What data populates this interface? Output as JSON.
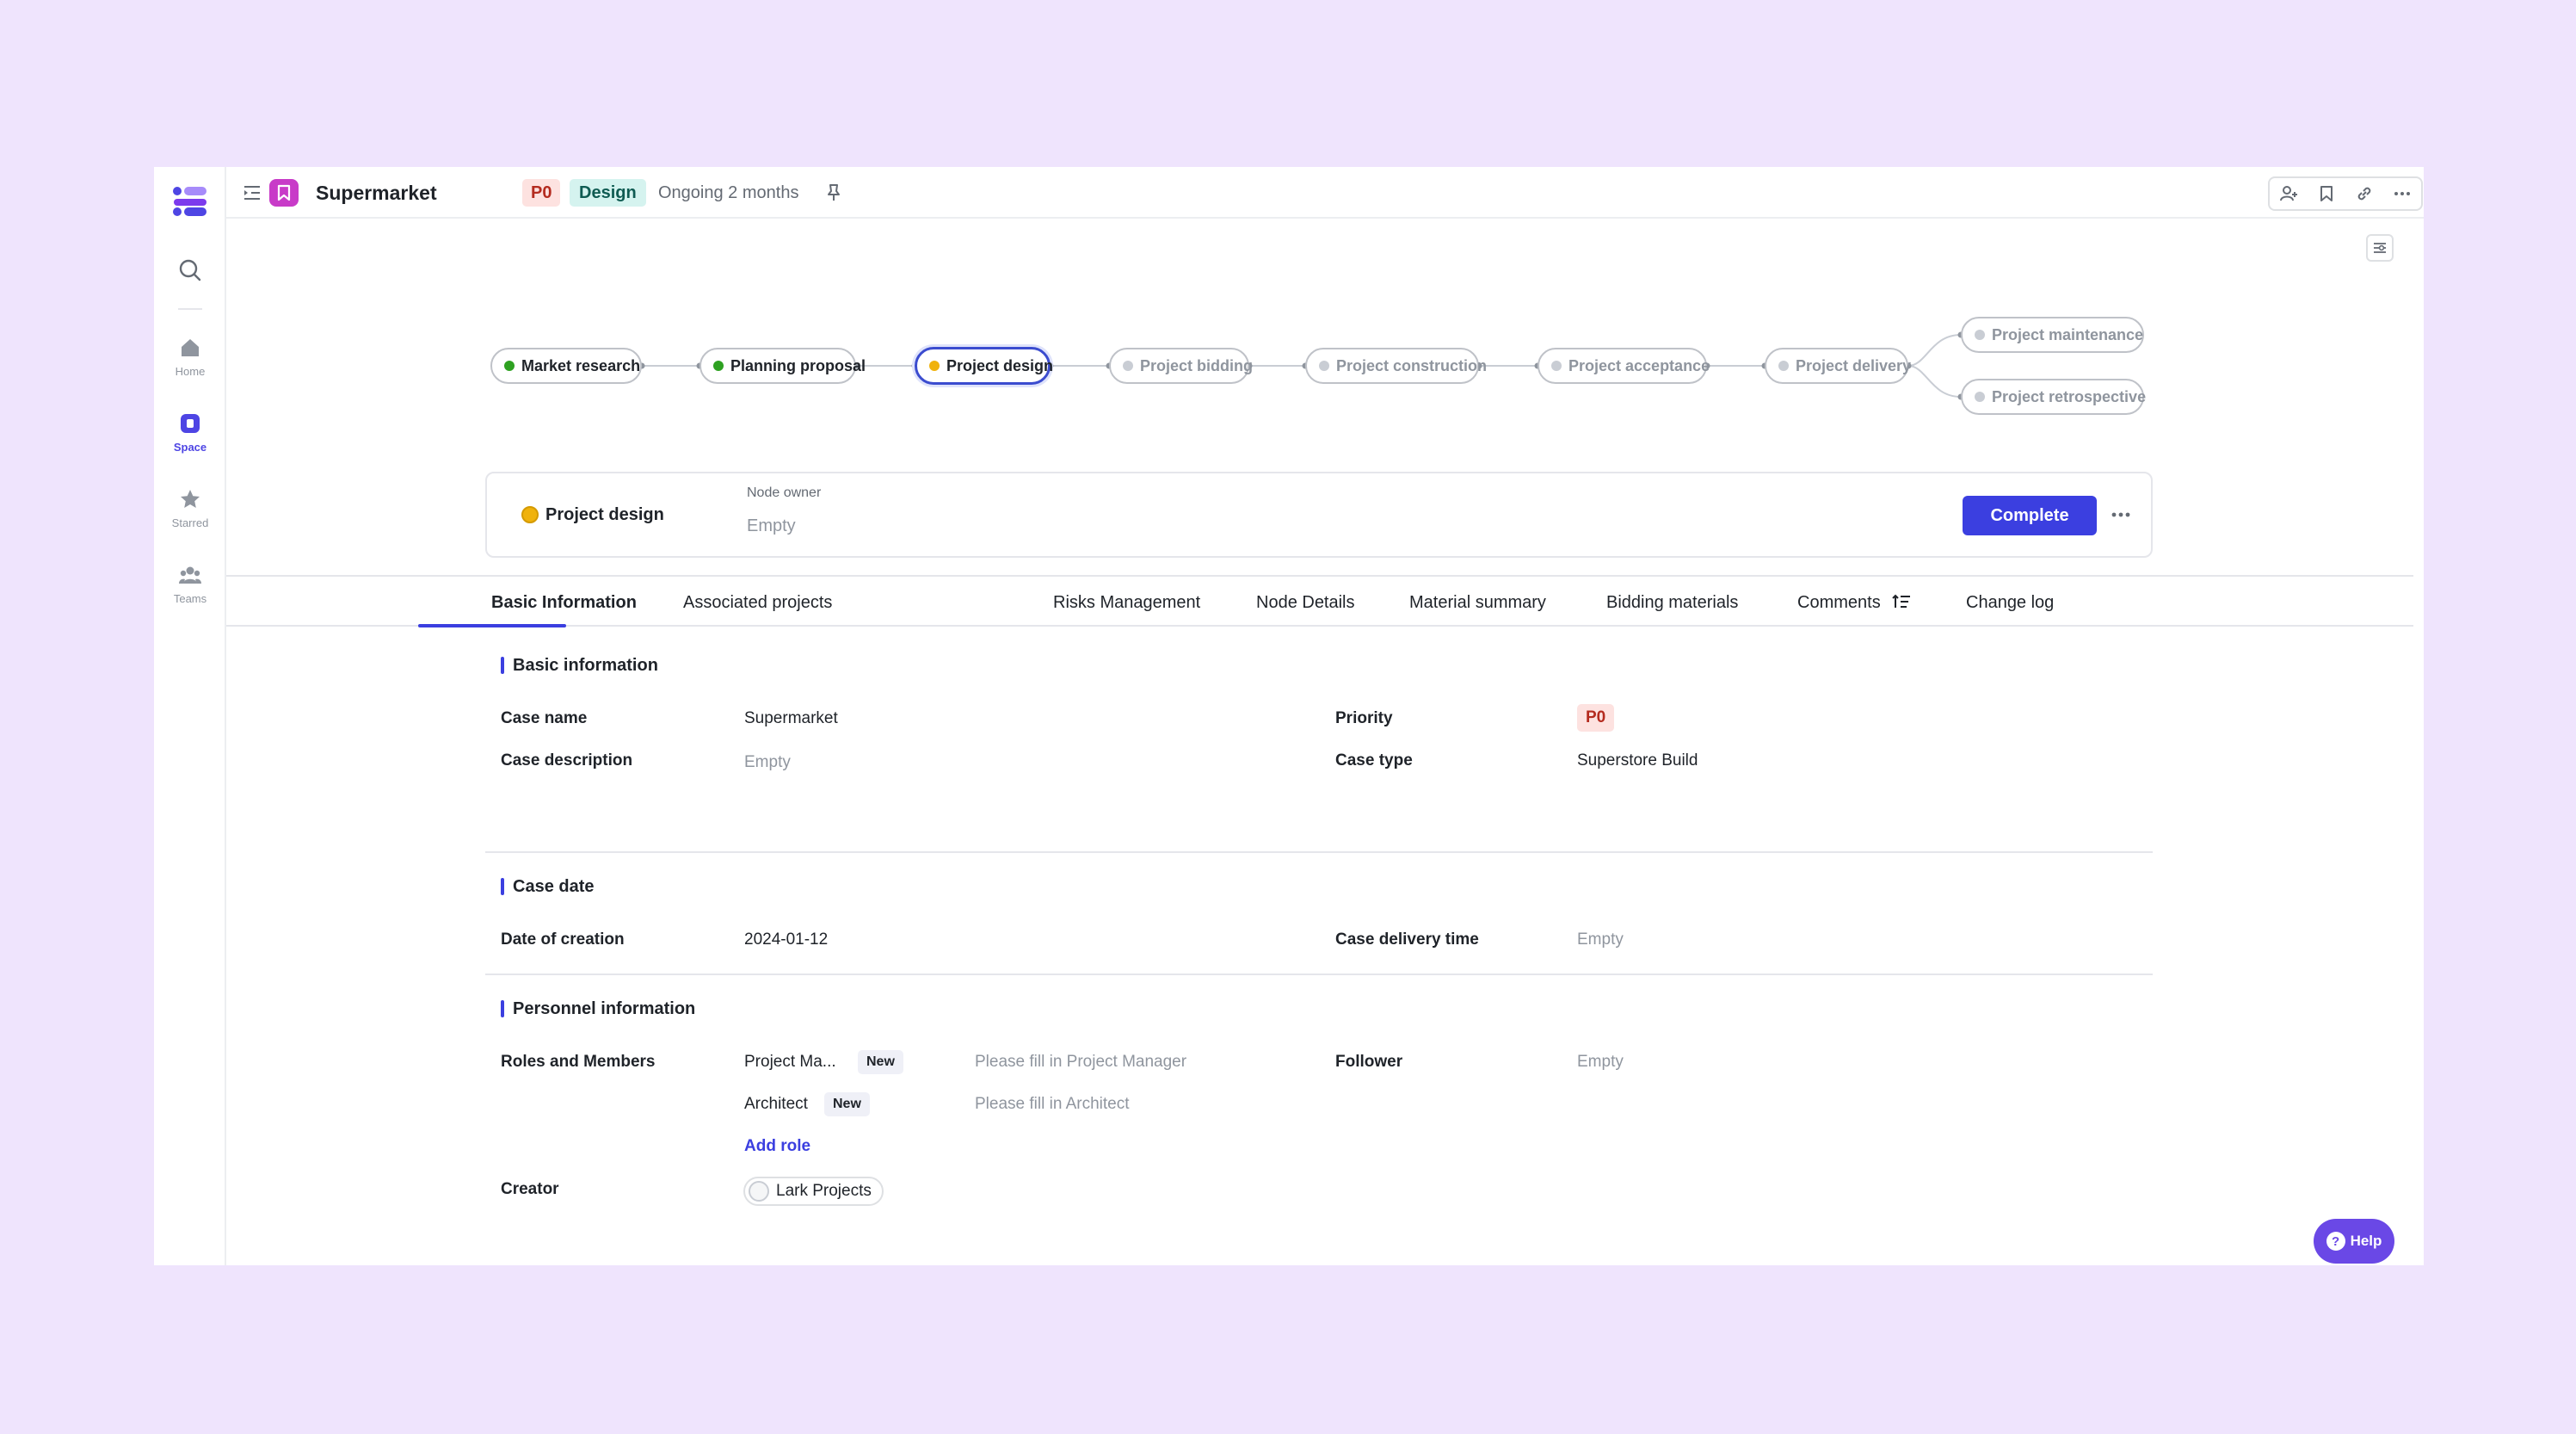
{
  "nav": {
    "items": [
      {
        "label": "Home",
        "icon": "home-icon"
      },
      {
        "label": "Space",
        "icon": "space-icon",
        "active": true
      },
      {
        "label": "Starred",
        "icon": "star-icon"
      },
      {
        "label": "Teams",
        "icon": "teams-icon"
      }
    ]
  },
  "header": {
    "title": "Supermarket",
    "priority": "P0",
    "tag": "Design",
    "status": "Ongoing 2 months"
  },
  "workflow": {
    "nodes": [
      {
        "label": "Market research",
        "state": "done"
      },
      {
        "label": "Planning proposal",
        "state": "done"
      },
      {
        "label": "Project design",
        "state": "current"
      },
      {
        "label": "Project bidding",
        "state": "pending"
      },
      {
        "label": "Project construction",
        "state": "pending"
      },
      {
        "label": "Project acceptance",
        "state": "pending"
      },
      {
        "label": "Project delivery",
        "state": "pending"
      },
      {
        "label": "Project maintenance",
        "state": "pending"
      },
      {
        "label": "Project retrospective",
        "state": "pending"
      }
    ]
  },
  "node_card": {
    "name": "Project design",
    "owner_label": "Node owner",
    "owner_value": "Empty",
    "complete_label": "Complete"
  },
  "tabs": [
    "Basic Information",
    "Associated projects",
    "Risks Management",
    "Node Details",
    "Material summary",
    "Bidding materials",
    "Comments",
    "Change log"
  ],
  "basic_info": {
    "title": "Basic information",
    "case_name_label": "Case name",
    "case_name": "Supermarket",
    "case_description_label": "Case description",
    "case_description": "Empty",
    "priority_label": "Priority",
    "priority": "P0",
    "case_type_label": "Case type",
    "case_type": "Superstore Build"
  },
  "case_date": {
    "title": "Case date",
    "creation_label": "Date of creation",
    "creation": "2024-01-12",
    "delivery_label": "Case delivery time",
    "delivery": "Empty"
  },
  "personnel": {
    "title": "Personnel information",
    "roles_label": "Roles and Members",
    "roles": [
      {
        "name": "Project Ma...",
        "badge": "New",
        "placeholder": "Please fill in Project Manager"
      },
      {
        "name": "Architect",
        "badge": "New",
        "placeholder": "Please fill in Architect"
      }
    ],
    "add_role": "Add role",
    "follower_label": "Follower",
    "follower": "Empty",
    "creator_label": "Creator",
    "creator": "Lark Projects"
  },
  "help_label": "Help",
  "colors": {
    "accent": "#3b3fe0",
    "background": "#efe4fd",
    "done": "#2ea121",
    "current": "#f0b20c"
  }
}
